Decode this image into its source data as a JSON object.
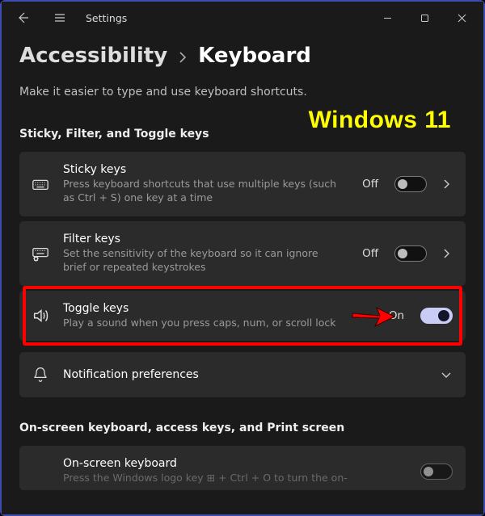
{
  "titlebar": {
    "title": "Settings"
  },
  "breadcrumb": {
    "parent": "Accessibility",
    "current": "Keyboard"
  },
  "subtitle": "Make it easier to type and use keyboard shortcuts.",
  "annotation": {
    "os_label": "Windows 11"
  },
  "sections": {
    "a": {
      "label": "Sticky, Filter, and Toggle keys",
      "sticky": {
        "title": "Sticky keys",
        "desc": "Press keyboard shortcuts that use multiple keys (such as Ctrl + S) one key at a time",
        "state": "Off"
      },
      "filter": {
        "title": "Filter keys",
        "desc": "Set the sensitivity of the keyboard so it can ignore brief or repeated keystrokes",
        "state": "Off"
      },
      "toggle": {
        "title": "Toggle keys",
        "desc": "Play a sound when you press caps, num, or scroll lock",
        "state": "On"
      },
      "notif": {
        "title": "Notification preferences"
      }
    },
    "b": {
      "label": "On-screen keyboard, access keys, and Print screen",
      "osk": {
        "title": "On-screen keyboard",
        "desc_truncated": "Press the Windows logo key ⊞ + Ctrl + O to turn the on-"
      }
    }
  }
}
